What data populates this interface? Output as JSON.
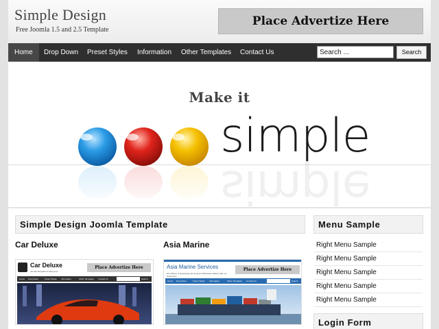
{
  "header": {
    "site_title": "Simple Design",
    "tagline": "Free Joomla 1.5 and 2.5 Template",
    "ad_text": "Place Advertize Here"
  },
  "nav": {
    "items": [
      "Home",
      "Drop Down",
      "Preset Styles",
      "Information",
      "Other Templates",
      "Contact Us"
    ],
    "active": "Home"
  },
  "search": {
    "value": "Search ...",
    "button": "Search"
  },
  "hero": {
    "headline": "Make it",
    "word": "simple",
    "ball_colors": [
      "#1e8fe0",
      "#e0241c",
      "#f5c000"
    ]
  },
  "main": {
    "heading": "Simple Design Joomla Template",
    "items": [
      {
        "title": "Car Deluxe",
        "thumb_site": "Car Deluxe",
        "thumb_tagline": "Joomla Template for Everyone",
        "thumb_ad": "Place Advertize Here"
      },
      {
        "title": "Asia Marine",
        "thumb_site": "Asia Marine Services",
        "thumb_tagline": "Our Marine is developing into long term Business relation with our Customers",
        "thumb_ad": "Place Advertize Here"
      }
    ],
    "thumb_nav": [
      "Home",
      "Drop Down",
      "Preset Styles",
      "Information",
      "Other Templates",
      "Contact Us"
    ],
    "thumb_search_button": "Search"
  },
  "sidebar": {
    "menu_heading": "Menu Sample",
    "menu_items": [
      "Right Menu Sample",
      "Right Menu Sample",
      "Right Menu Sample",
      "Right Menu Sample",
      "Right Menu Sample"
    ],
    "login_heading": "Login Form"
  }
}
